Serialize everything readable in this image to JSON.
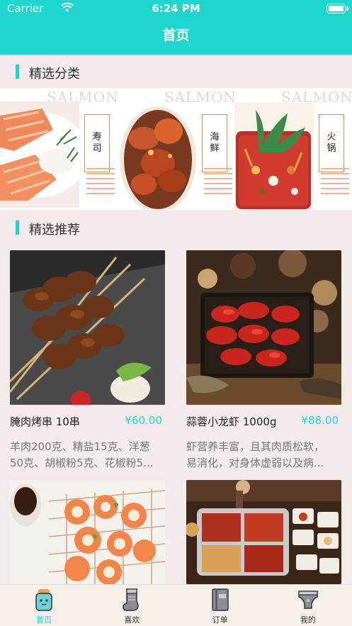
{
  "status_bar": {
    "carrier": "Carrier",
    "time": "6:24 PM"
  },
  "nav": {
    "title": "首页"
  },
  "sections": {
    "featured_categories": "精选分类",
    "featured_recommend": "精选推荐"
  },
  "banner": {
    "watermark": "SALMON",
    "cards": [
      {
        "label_top": "寿",
        "label_bottom": "司",
        "icon": "sushi-salmon-image"
      },
      {
        "label_top": "海",
        "label_bottom": "鲜",
        "icon": "seafood-crab-image"
      },
      {
        "label_top": "火",
        "label_bottom": "锅",
        "icon": "hotpot-image"
      }
    ]
  },
  "products": [
    {
      "name": "腌肉烤串 10串",
      "price": "¥60.00",
      "desc_line1": "羊肉200克、精盐15克、洋葱",
      "desc_line2": "50克、胡椒粉5克、花椒粉5...",
      "icon": "grilled-skewers-image"
    },
    {
      "name": "蒜蓉小龙虾 1000g",
      "price": "¥88.00",
      "desc_line1": "虾营养丰富，且其肉质松软，",
      "desc_line2": "易消化，对身体虚弱以及病...",
      "icon": "crayfish-image"
    },
    {
      "icon": "salmon-rolls-image"
    },
    {
      "icon": "hotpot-table-image"
    }
  ],
  "tabs": [
    {
      "label": "首页",
      "icon": "home-icon",
      "active": true
    },
    {
      "label": "喜欢",
      "icon": "sock-icon",
      "active": false
    },
    {
      "label": "订单",
      "icon": "book-icon",
      "active": false
    },
    {
      "label": "我的",
      "icon": "diaper-icon",
      "active": false
    }
  ],
  "colors": {
    "accent": "#1fd6cf",
    "background": "#f3eaea",
    "price": "#1fd6cf"
  }
}
